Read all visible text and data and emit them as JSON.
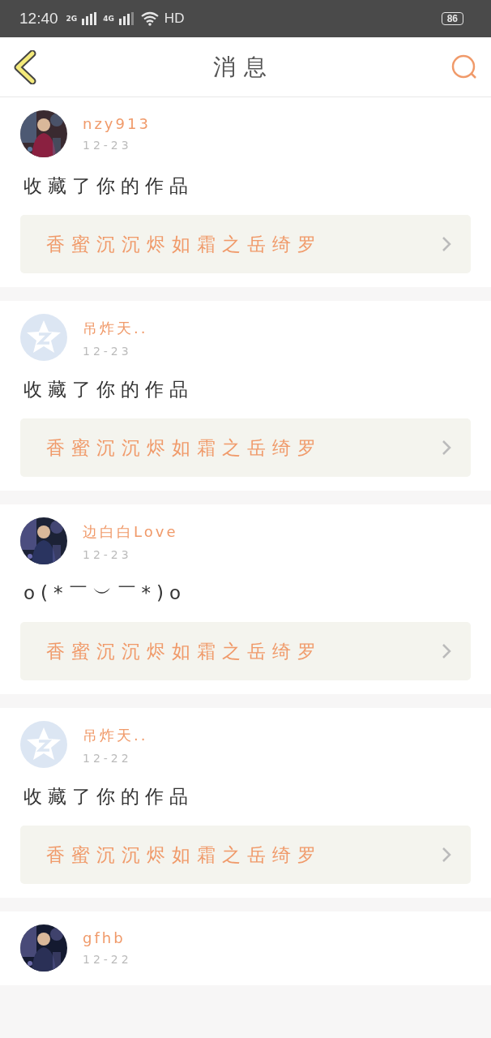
{
  "status_bar": {
    "time": "12:40",
    "network_1": "2G",
    "network_2": "4G",
    "hd": "HD",
    "battery": "86"
  },
  "header": {
    "title": "消息"
  },
  "messages": [
    {
      "name": "nzy913",
      "date": "12-23",
      "text": "收藏了你的作品",
      "work": "香蜜沉沉烬如霜之岳绮罗"
    },
    {
      "avatar": {
        "kind": "default"
      },
      "name": "吊炸天..",
      "date": "12-23",
      "text": "收藏了你的作品",
      "work": "香蜜沉沉烬如霜之岳绮罗"
    },
    {
      "name": "边白白Love",
      "date": "12-23",
      "text": "o(*￣︶￣*)o",
      "work": "香蜜沉沉烬如霜之岳绮罗"
    },
    {
      "avatar": {
        "kind": "default"
      },
      "name": "吊炸天..",
      "date": "12-22",
      "text": "收藏了你的作品",
      "work": "香蜜沉沉烬如霜之岳绮罗"
    },
    {
      "name": "gfhb",
      "date": "12-22"
    }
  ]
}
